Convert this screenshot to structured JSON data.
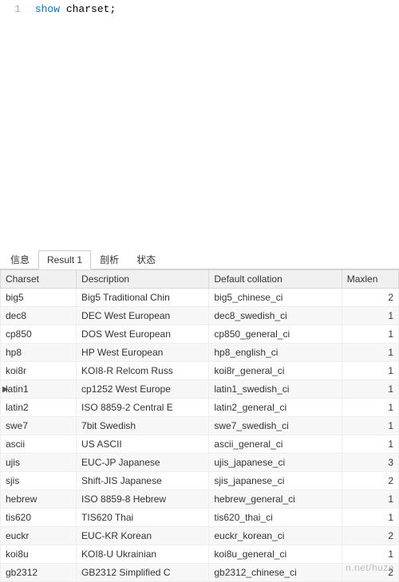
{
  "editor": {
    "line_number": "1",
    "keyword": "show",
    "rest": " charset;"
  },
  "tabs": [
    {
      "label": "信息",
      "active": false
    },
    {
      "label": "Result 1",
      "active": true
    },
    {
      "label": "剖析",
      "active": false
    },
    {
      "label": "状态",
      "active": false
    }
  ],
  "columns": {
    "charset": "Charset",
    "description": "Description",
    "collation": "Default collation",
    "maxlen": "Maxlen"
  },
  "selected_row_index": 5,
  "rows": [
    {
      "charset": "big5",
      "description": "Big5 Traditional Chin",
      "collation": "big5_chinese_ci",
      "maxlen": "2"
    },
    {
      "charset": "dec8",
      "description": "DEC West European",
      "collation": "dec8_swedish_ci",
      "maxlen": "1"
    },
    {
      "charset": "cp850",
      "description": "DOS West European",
      "collation": "cp850_general_ci",
      "maxlen": "1"
    },
    {
      "charset": "hp8",
      "description": "HP West European",
      "collation": "hp8_english_ci",
      "maxlen": "1"
    },
    {
      "charset": "koi8r",
      "description": "KOI8-R Relcom Russ",
      "collation": "koi8r_general_ci",
      "maxlen": "1"
    },
    {
      "charset": "latin1",
      "description": "cp1252 West Europe",
      "collation": "latin1_swedish_ci",
      "maxlen": "1"
    },
    {
      "charset": "latin2",
      "description": "ISO 8859-2 Central E",
      "collation": "latin2_general_ci",
      "maxlen": "1"
    },
    {
      "charset": "swe7",
      "description": "7bit Swedish",
      "collation": "swe7_swedish_ci",
      "maxlen": "1"
    },
    {
      "charset": "ascii",
      "description": "US ASCII",
      "collation": "ascii_general_ci",
      "maxlen": "1"
    },
    {
      "charset": "ujis",
      "description": "EUC-JP Japanese",
      "collation": "ujis_japanese_ci",
      "maxlen": "3"
    },
    {
      "charset": "sjis",
      "description": "Shift-JIS Japanese",
      "collation": "sjis_japanese_ci",
      "maxlen": "2"
    },
    {
      "charset": "hebrew",
      "description": "ISO 8859-8 Hebrew",
      "collation": "hebrew_general_ci",
      "maxlen": "1"
    },
    {
      "charset": "tis620",
      "description": "TIS620 Thai",
      "collation": "tis620_thai_ci",
      "maxlen": "1"
    },
    {
      "charset": "euckr",
      "description": "EUC-KR Korean",
      "collation": "euckr_korean_ci",
      "maxlen": "2"
    },
    {
      "charset": "koi8u",
      "description": "KOI8-U Ukrainian",
      "collation": "koi8u_general_ci",
      "maxlen": "1"
    },
    {
      "charset": "gb2312",
      "description": "GB2312 Simplified C",
      "collation": "gb2312_chinese_ci",
      "maxlen": "2"
    }
  ],
  "watermark": "n.net/huze"
}
